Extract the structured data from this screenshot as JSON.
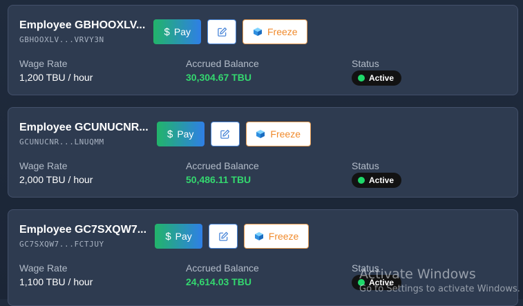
{
  "labels": {
    "wage_rate": "Wage Rate",
    "accrued_balance": "Accrued Balance",
    "status": "Status"
  },
  "buttons": {
    "pay": "Pay",
    "freeze": "Freeze",
    "pay_icon": "$"
  },
  "icons": {
    "pay": "dollar-icon",
    "edit": "pencil-square-icon",
    "freeze": "ice-cube-icon"
  },
  "colors": {
    "accent_green": "#34d86f",
    "status_dot": "#1fd86a",
    "freeze_orange": "#f08a2b",
    "edit_blue": "#4a86d8"
  },
  "employees": [
    {
      "title": "Employee GBHOOXLV...",
      "address": "GBHOOXLV...VRVY3N",
      "wage_rate": "1,200 TBU / hour",
      "accrued_balance": "30,304.67 TBU",
      "status": "Active"
    },
    {
      "title": "Employee GCUNUCNR...",
      "address": "GCUNUCNR...LNUQMM",
      "wage_rate": "2,000 TBU / hour",
      "accrued_balance": "50,486.11 TBU",
      "status": "Active"
    },
    {
      "title": "Employee GC7SXQW7...",
      "address": "GC7SXQW7...FCTJUY",
      "wage_rate": "1,100 TBU / hour",
      "accrued_balance": "24,614.03 TBU",
      "status": "Active"
    }
  ],
  "watermark": {
    "title": "Activate Windows",
    "subtitle": "Go to Settings to activate Windows."
  }
}
